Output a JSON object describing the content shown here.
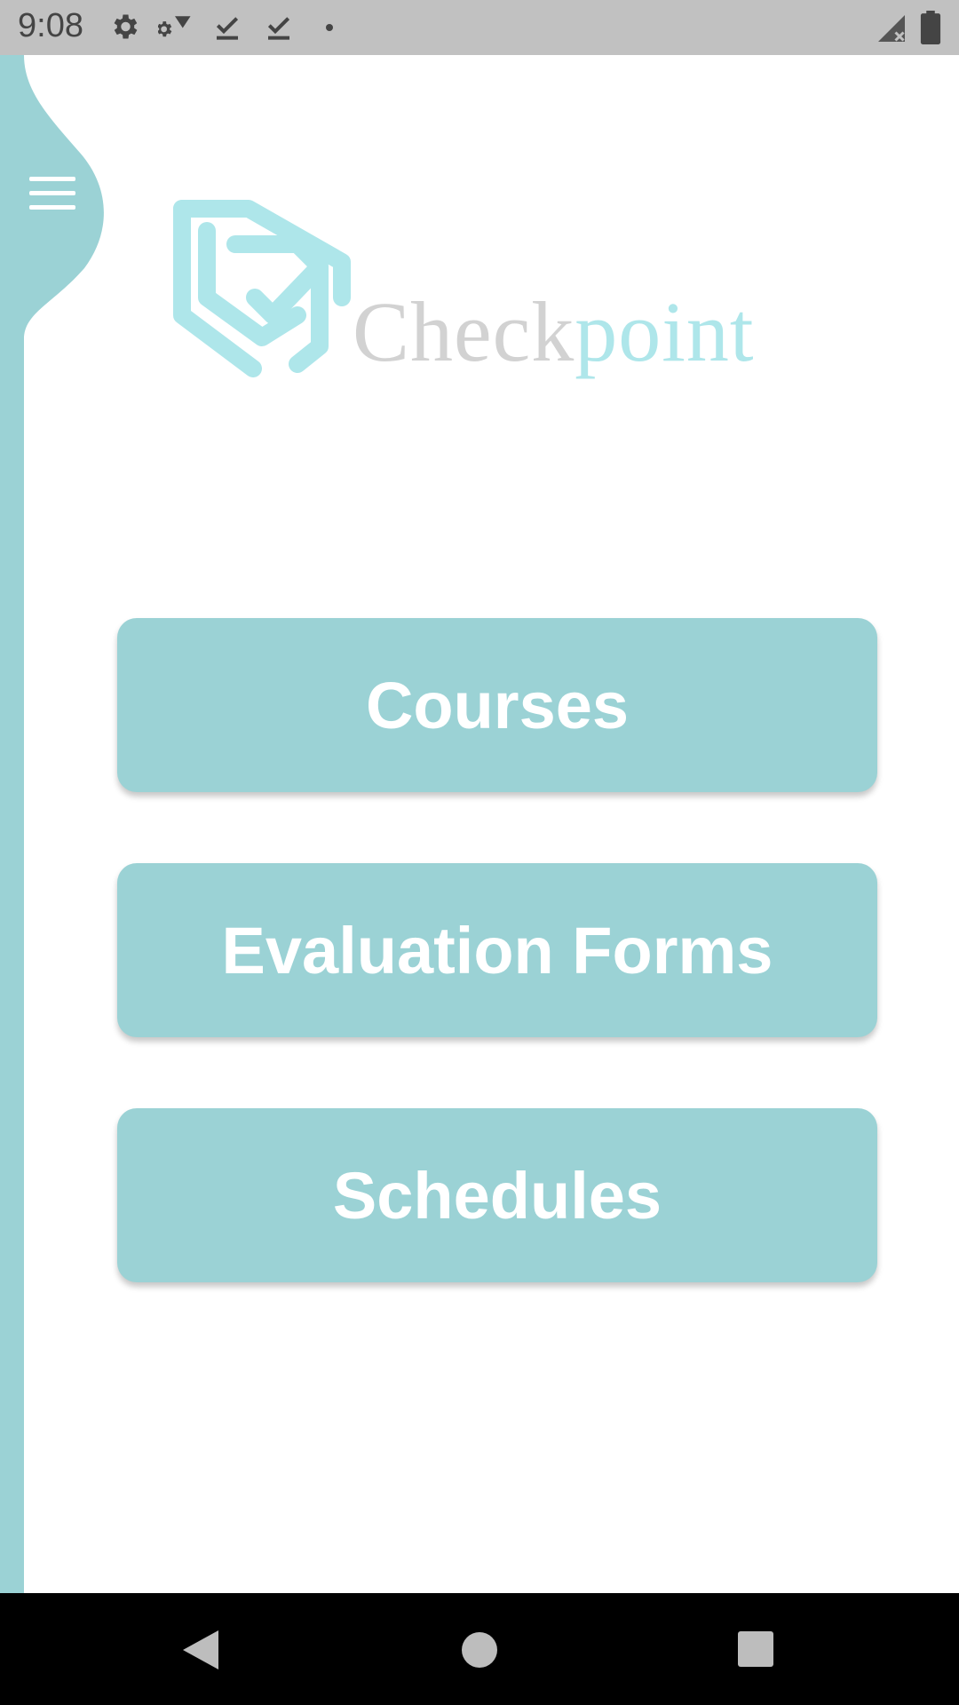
{
  "status_bar": {
    "time": "9:08",
    "icons": [
      "gear-icon",
      "gear-wifi-icon",
      "download-done-icon",
      "download-done-icon",
      "dot-icon",
      "signal-icon",
      "battery-icon"
    ]
  },
  "app": {
    "logo_text_part1": "Check",
    "logo_text_part2": "point",
    "menu_icon": "hamburger-icon"
  },
  "buttons": {
    "courses": "Courses",
    "evaluation_forms": "Evaluation Forms",
    "schedules": "Schedules"
  },
  "nav_bar": {
    "icons": [
      "back-icon",
      "home-icon",
      "recents-icon"
    ]
  },
  "colors": {
    "accent": "#9bd2d5",
    "logo_teal": "#aee6ea",
    "logo_gray": "#d2d2d2",
    "status_bar": "#c1c1c1"
  }
}
